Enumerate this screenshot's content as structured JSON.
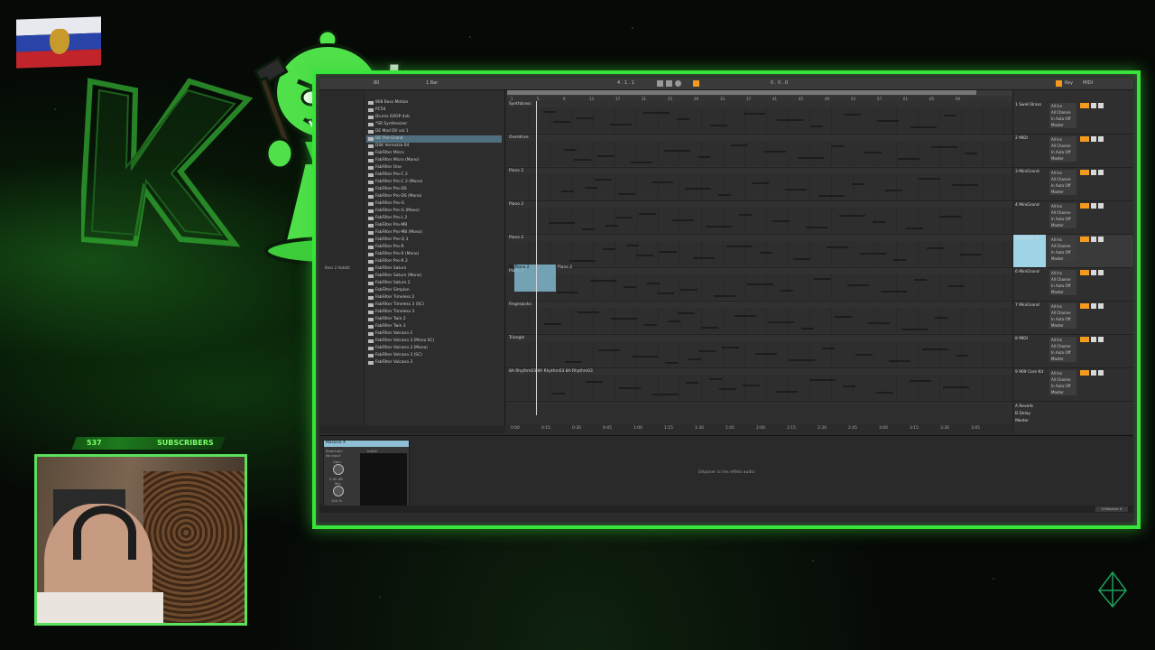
{
  "overlay": {
    "subscribers_count": "537",
    "subscribers_label": "SUBSCRIBERS"
  },
  "daw": {
    "tempo": "1 Bar",
    "position": "4 . 1 . 1",
    "end_position": "0 . 0 . 0",
    "key_label": "Key",
    "midi_label": "MIDI",
    "browser_items": [
      "808 Bass Motion",
      "PC54",
      "Drums SOOP 4vb",
      "*SR Synthesizer",
      "DE Mod DV vol 1",
      "DE The Grand",
      "DSK Vernezza 64",
      "FabFilter Micro",
      "FabFilter Micro (Mono)",
      "FabFilter One",
      "FabFilter Pro-C 2",
      "FabFilter Pro-C 2 (Mono)",
      "FabFilter Pro-DS",
      "FabFilter Pro-DS (Mono)",
      "FabFilter Pro-G",
      "FabFilter Pro-G (Mono)",
      "FabFilter Pro-L 2",
      "FabFilter Pro-MB",
      "FabFilter Pro-MB (Mono)",
      "FabFilter Pro-Q 3",
      "FabFilter Pro-R",
      "FabFilter Pro-R (Mono)",
      "FabFilter Pro-R 2",
      "FabFilter Saturn",
      "FabFilter Saturn (Mono)",
      "FabFilter Saturn 2",
      "FabFilter Simplon",
      "FabFilter Timeless 2",
      "FabFilter Timeless 3 (SC)",
      "FabFilter Timeless 3",
      "FabFilter Twin 2",
      "FabFilter Twin 3",
      "FabFilter Volcano 2",
      "FabFilter Volcano 3 (Mono SC)",
      "FabFilter Volcano 3 (Mono)",
      "FabFilter Volcano 3 (SC)",
      "FabFilter Volcano 3"
    ],
    "browser_category": "Bass 2 Hobbit",
    "tracks": [
      {
        "name": "Synthbrass",
        "mixer": "1 Swell Brass"
      },
      {
        "name": "Overdrive",
        "mixer": "2 MIDI"
      },
      {
        "name": "Piano 2",
        "mixer": "3 MiniGrand"
      },
      {
        "name": "Piano 2",
        "mixer": "4 MiniGrand"
      },
      {
        "name": "Piano 2",
        "mixer": "5 Massive X"
      },
      {
        "name": "Piano 2",
        "mixer": "6 MiniGrand"
      },
      {
        "name": "Fingerpicks",
        "mixer": "7 MiniGrand"
      },
      {
        "name": "Triangle",
        "mixer": "8 MIDI"
      },
      {
        "name": "8A Rhythm03 8A Rhythm03 8A Rhythm03",
        "mixer": "9 909 Core Kit"
      }
    ],
    "clip_label_left": "Pc Piano 2",
    "clip_label_right": "Piano 2",
    "mixer_io": [
      "All Ins",
      "All Channe",
      "In Auto Off",
      "Master"
    ],
    "return_tracks": [
      "A Reverb",
      "B Delay",
      "Master"
    ],
    "bar_ruler": [
      "1",
      "5",
      "9",
      "13",
      "17",
      "21",
      "25",
      "29",
      "33",
      "37",
      "41",
      "45",
      "49",
      "53",
      "57",
      "61",
      "65",
      "69"
    ],
    "time_ruler": [
      "0:00",
      "0:15",
      "0:30",
      "0:45",
      "1:00",
      "1:15",
      "1:30",
      "1:45",
      "2:00",
      "2:15",
      "2:30",
      "2:45",
      "3:00",
      "3:15",
      "3:30",
      "3:45"
    ],
    "device_name": "Massive X",
    "device_sidechain": "Sidechain",
    "device_no_input": "No Input",
    "device_gain": "Gain",
    "device_gain_val": "0.00 dB",
    "device_mix": "Mix",
    "device_mix_val": "100 %",
    "device_preset": "Init02",
    "drop_message": "Déposer ici les effets audio",
    "status_track": "5-Massive X"
  }
}
